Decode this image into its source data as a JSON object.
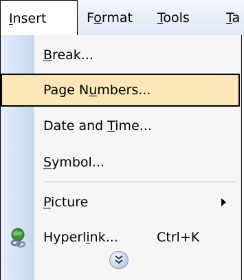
{
  "menubar": {
    "items": [
      {
        "pre": "",
        "mn": "I",
        "post": "nsert"
      },
      {
        "pre": "F",
        "mn": "o",
        "post": "rmat"
      },
      {
        "pre": "",
        "mn": "T",
        "post": "ools"
      },
      {
        "pre": "",
        "mn": "T",
        "post": "a"
      }
    ]
  },
  "menu": {
    "items": [
      {
        "pre": "",
        "mn": "B",
        "post": "reak..."
      },
      {
        "pre": "Page N",
        "mn": "u",
        "post": "mbers..."
      },
      {
        "pre": "Date and ",
        "mn": "T",
        "post": "ime..."
      },
      {
        "pre": "",
        "mn": "S",
        "post": "ymbol..."
      },
      {
        "pre": "",
        "mn": "P",
        "post": "icture"
      },
      {
        "pre": "Hyperl",
        "mn": "i",
        "post": "nk...",
        "shortcut": "Ctrl+K"
      }
    ]
  },
  "icons": {
    "submenu": "chevron-right-icon",
    "hyperlink": "globe-chain-icon",
    "expand": "double-chevron-down-icon"
  },
  "colors": {
    "highlight": "#fbe7b8",
    "gutter": "#c7d7ee",
    "menubar": "#dfe7f3"
  }
}
